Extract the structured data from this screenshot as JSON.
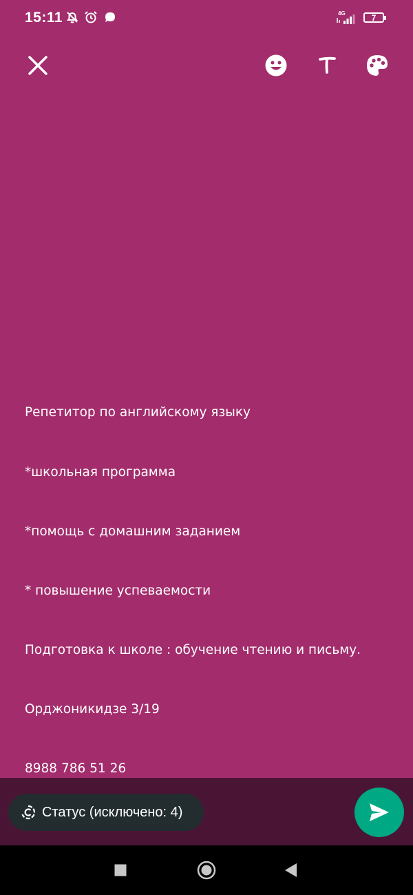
{
  "status_bar": {
    "time": "15:11",
    "network": "4G",
    "battery": "7",
    "icons": [
      "muted-alarm-icon",
      "alarm-clock-icon",
      "chat-bubble-icon",
      "signal-icon",
      "battery-icon"
    ]
  },
  "top_bar": {
    "icons": [
      "close-icon",
      "emoji-icon",
      "text-icon",
      "palette-icon"
    ]
  },
  "story": {
    "background_color": "#a32c6c",
    "lines": [
      "Репетитор по английскому языку",
      "*школьная программа",
      "*помощь с домашним заданием",
      "* повышение успеваемости",
      "Подготовка к школе : обучение чтению и письму.",
      "Орджоникидзе 3/19",
      "8988 786 51 26"
    ]
  },
  "composer": {
    "audience_label": "Статус (исключено: 4)",
    "accent_color": "#00a884"
  },
  "nav_bar": {
    "icons": [
      "recents-icon",
      "home-icon",
      "back-icon"
    ]
  }
}
